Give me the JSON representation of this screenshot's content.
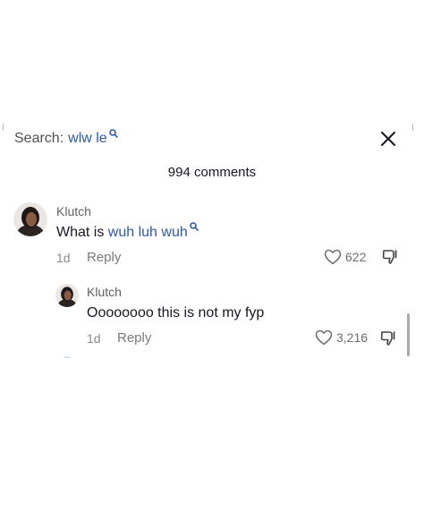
{
  "search": {
    "prefix": "Search:",
    "query": "wlw le",
    "link_color": "#2d5aa8"
  },
  "comments_header": {
    "count_label": "994 comments"
  },
  "comments": [
    {
      "username": "Klutch",
      "text_prefix": "What is ",
      "text_link": "wuh luh wuh",
      "age": "1d",
      "reply_label": "Reply",
      "likes": "622"
    },
    {
      "username": "Klutch",
      "text": "Oooooooo this is not my fyp",
      "age": "1d",
      "reply_label": "Reply",
      "likes": "3,216"
    }
  ],
  "icons": {
    "search_suffix": "magnifier-icon",
    "close": "close-icon",
    "like": "heart-icon",
    "dislike": "thumbs-down-icon"
  }
}
